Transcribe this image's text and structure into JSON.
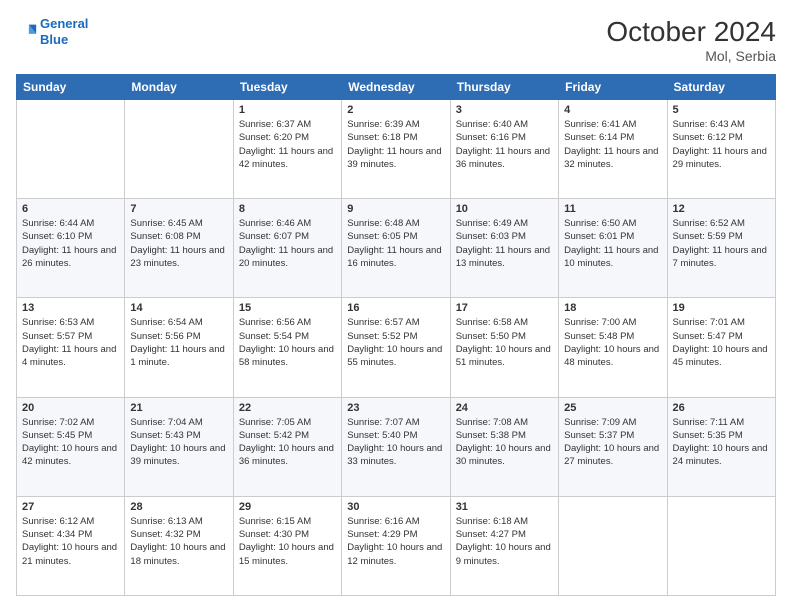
{
  "header": {
    "logo_line1": "General",
    "logo_line2": "Blue",
    "title": "October 2024",
    "subtitle": "Mol, Serbia"
  },
  "weekdays": [
    "Sunday",
    "Monday",
    "Tuesday",
    "Wednesday",
    "Thursday",
    "Friday",
    "Saturday"
  ],
  "weeks": [
    [
      {
        "day": "",
        "info": ""
      },
      {
        "day": "",
        "info": ""
      },
      {
        "day": "1",
        "info": "Sunrise: 6:37 AM\nSunset: 6:20 PM\nDaylight: 11 hours and 42 minutes."
      },
      {
        "day": "2",
        "info": "Sunrise: 6:39 AM\nSunset: 6:18 PM\nDaylight: 11 hours and 39 minutes."
      },
      {
        "day": "3",
        "info": "Sunrise: 6:40 AM\nSunset: 6:16 PM\nDaylight: 11 hours and 36 minutes."
      },
      {
        "day": "4",
        "info": "Sunrise: 6:41 AM\nSunset: 6:14 PM\nDaylight: 11 hours and 32 minutes."
      },
      {
        "day": "5",
        "info": "Sunrise: 6:43 AM\nSunset: 6:12 PM\nDaylight: 11 hours and 29 minutes."
      }
    ],
    [
      {
        "day": "6",
        "info": "Sunrise: 6:44 AM\nSunset: 6:10 PM\nDaylight: 11 hours and 26 minutes."
      },
      {
        "day": "7",
        "info": "Sunrise: 6:45 AM\nSunset: 6:08 PM\nDaylight: 11 hours and 23 minutes."
      },
      {
        "day": "8",
        "info": "Sunrise: 6:46 AM\nSunset: 6:07 PM\nDaylight: 11 hours and 20 minutes."
      },
      {
        "day": "9",
        "info": "Sunrise: 6:48 AM\nSunset: 6:05 PM\nDaylight: 11 hours and 16 minutes."
      },
      {
        "day": "10",
        "info": "Sunrise: 6:49 AM\nSunset: 6:03 PM\nDaylight: 11 hours and 13 minutes."
      },
      {
        "day": "11",
        "info": "Sunrise: 6:50 AM\nSunset: 6:01 PM\nDaylight: 11 hours and 10 minutes."
      },
      {
        "day": "12",
        "info": "Sunrise: 6:52 AM\nSunset: 5:59 PM\nDaylight: 11 hours and 7 minutes."
      }
    ],
    [
      {
        "day": "13",
        "info": "Sunrise: 6:53 AM\nSunset: 5:57 PM\nDaylight: 11 hours and 4 minutes."
      },
      {
        "day": "14",
        "info": "Sunrise: 6:54 AM\nSunset: 5:56 PM\nDaylight: 11 hours and 1 minute."
      },
      {
        "day": "15",
        "info": "Sunrise: 6:56 AM\nSunset: 5:54 PM\nDaylight: 10 hours and 58 minutes."
      },
      {
        "day": "16",
        "info": "Sunrise: 6:57 AM\nSunset: 5:52 PM\nDaylight: 10 hours and 55 minutes."
      },
      {
        "day": "17",
        "info": "Sunrise: 6:58 AM\nSunset: 5:50 PM\nDaylight: 10 hours and 51 minutes."
      },
      {
        "day": "18",
        "info": "Sunrise: 7:00 AM\nSunset: 5:48 PM\nDaylight: 10 hours and 48 minutes."
      },
      {
        "day": "19",
        "info": "Sunrise: 7:01 AM\nSunset: 5:47 PM\nDaylight: 10 hours and 45 minutes."
      }
    ],
    [
      {
        "day": "20",
        "info": "Sunrise: 7:02 AM\nSunset: 5:45 PM\nDaylight: 10 hours and 42 minutes."
      },
      {
        "day": "21",
        "info": "Sunrise: 7:04 AM\nSunset: 5:43 PM\nDaylight: 10 hours and 39 minutes."
      },
      {
        "day": "22",
        "info": "Sunrise: 7:05 AM\nSunset: 5:42 PM\nDaylight: 10 hours and 36 minutes."
      },
      {
        "day": "23",
        "info": "Sunrise: 7:07 AM\nSunset: 5:40 PM\nDaylight: 10 hours and 33 minutes."
      },
      {
        "day": "24",
        "info": "Sunrise: 7:08 AM\nSunset: 5:38 PM\nDaylight: 10 hours and 30 minutes."
      },
      {
        "day": "25",
        "info": "Sunrise: 7:09 AM\nSunset: 5:37 PM\nDaylight: 10 hours and 27 minutes."
      },
      {
        "day": "26",
        "info": "Sunrise: 7:11 AM\nSunset: 5:35 PM\nDaylight: 10 hours and 24 minutes."
      }
    ],
    [
      {
        "day": "27",
        "info": "Sunrise: 6:12 AM\nSunset: 4:34 PM\nDaylight: 10 hours and 21 minutes."
      },
      {
        "day": "28",
        "info": "Sunrise: 6:13 AM\nSunset: 4:32 PM\nDaylight: 10 hours and 18 minutes."
      },
      {
        "day": "29",
        "info": "Sunrise: 6:15 AM\nSunset: 4:30 PM\nDaylight: 10 hours and 15 minutes."
      },
      {
        "day": "30",
        "info": "Sunrise: 6:16 AM\nSunset: 4:29 PM\nDaylight: 10 hours and 12 minutes."
      },
      {
        "day": "31",
        "info": "Sunrise: 6:18 AM\nSunset: 4:27 PM\nDaylight: 10 hours and 9 minutes."
      },
      {
        "day": "",
        "info": ""
      },
      {
        "day": "",
        "info": ""
      }
    ]
  ]
}
